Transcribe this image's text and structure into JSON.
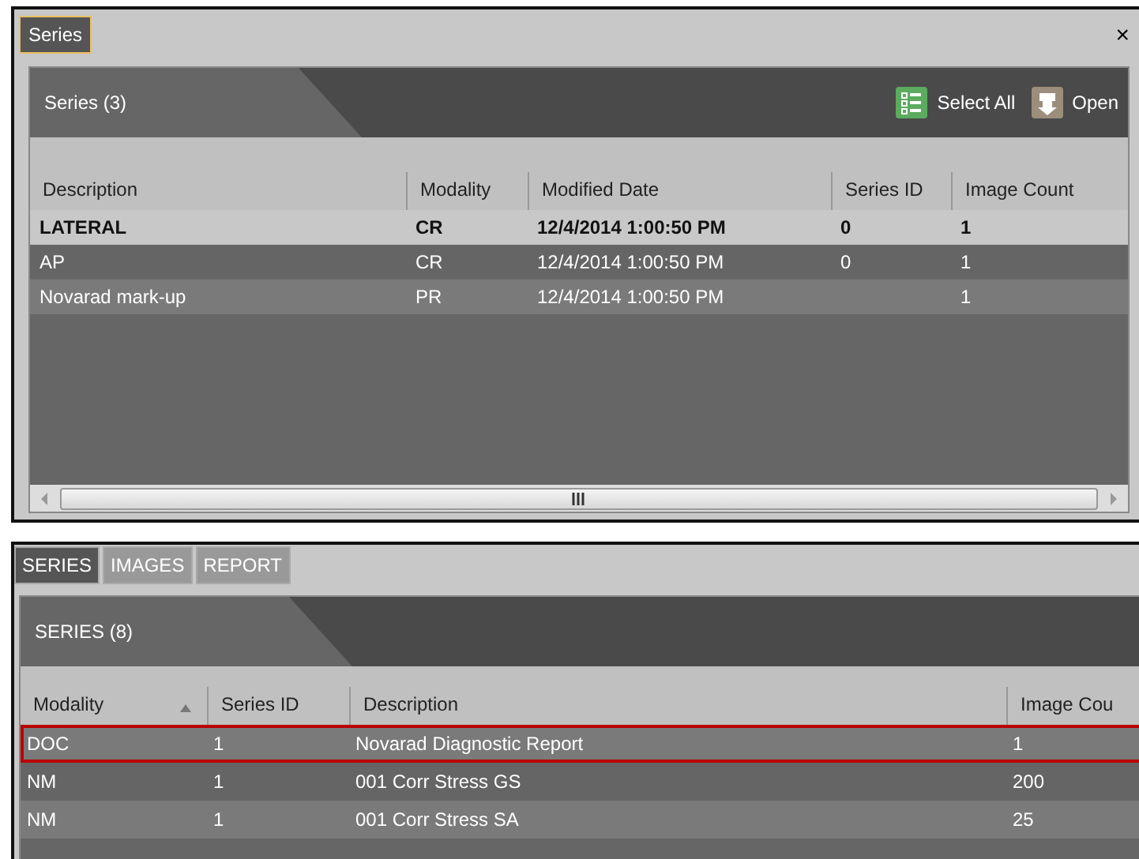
{
  "window": {
    "tab": {
      "label": "Series",
      "selected": true
    },
    "close": "×"
  },
  "series_panel": {
    "title": "Series (3)",
    "actions": [
      {
        "kind": "select",
        "label": "Select All"
      },
      {
        "kind": "open",
        "label": "Open"
      }
    ],
    "columns": [
      "Description",
      "Modality",
      "Modified Date",
      "Series ID",
      "Image Count"
    ],
    "rows": [
      {
        "cells": [
          "LATERAL",
          "CR",
          "12/4/2014 1:00:50 PM",
          "0",
          "1"
        ],
        "selected": true
      },
      {
        "cells": [
          "AP",
          "CR",
          "12/4/2014 1:00:50 PM",
          "0",
          "1"
        ],
        "selected": false
      },
      {
        "cells": [
          "Novarad mark-up",
          "PR",
          "12/4/2014 1:00:50 PM",
          "",
          "1"
        ],
        "selected": false
      }
    ]
  },
  "tabs": [
    {
      "label": "SERIES",
      "selected": true
    },
    {
      "label": "IMAGES",
      "selected": false
    },
    {
      "label": "REPORT",
      "selected": false
    }
  ],
  "lower_panel": {
    "title": "SERIES (8)",
    "columns": [
      {
        "label": "Modality",
        "sorted": true
      },
      {
        "label": "Series ID",
        "sorted": false
      },
      {
        "label": "Description",
        "sorted": false
      },
      {
        "label": "Image Cou",
        "sorted": false
      }
    ],
    "rows": [
      {
        "cells": [
          "DOC",
          "1",
          "Novarad Diagnostic Report",
          "1"
        ],
        "selected": true
      },
      {
        "cells": [
          "NM",
          "1",
          "001 Corr Stress GS",
          "200"
        ],
        "selected": false
      },
      {
        "cells": [
          "NM",
          "1",
          "001 Corr Stress SA",
          "25"
        ],
        "selected": false
      }
    ]
  }
}
